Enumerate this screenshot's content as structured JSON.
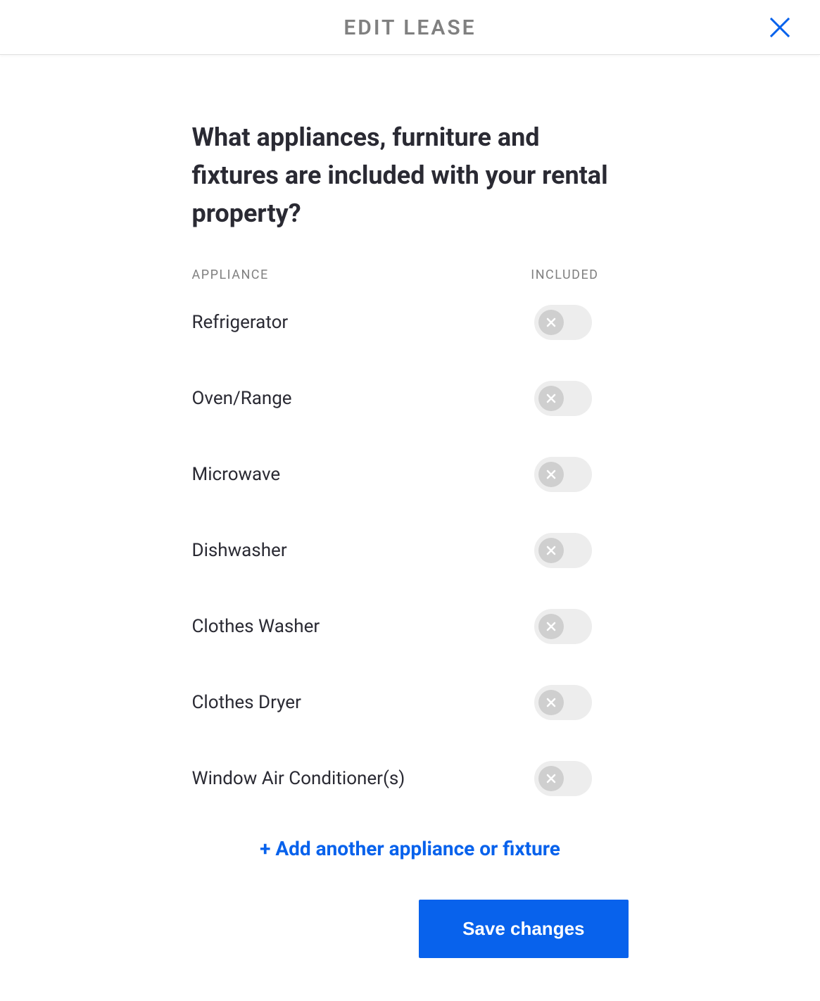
{
  "header": {
    "title": "EDIT LEASE"
  },
  "main": {
    "heading": "What appliances, furniture and fixtures are included with your rental property?",
    "columns": {
      "left": "APPLIANCE",
      "right": "INCLUDED"
    },
    "appliances": [
      {
        "name": "Refrigerator",
        "included": false
      },
      {
        "name": "Oven/Range",
        "included": false
      },
      {
        "name": "Microwave",
        "included": false
      },
      {
        "name": "Dishwasher",
        "included": false
      },
      {
        "name": "Clothes Washer",
        "included": false
      },
      {
        "name": "Clothes Dryer",
        "included": false
      },
      {
        "name": "Window Air Conditioner(s)",
        "included": false
      }
    ],
    "add_link": "+ Add another appliance or fixture",
    "save_button": "Save changes"
  }
}
